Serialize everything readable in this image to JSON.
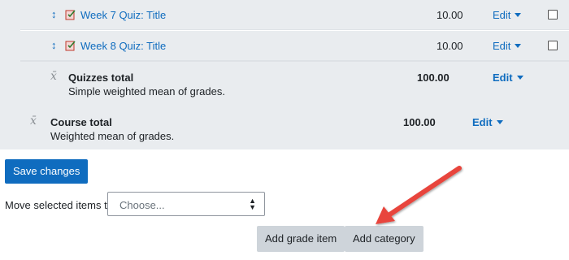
{
  "rows": [
    {
      "title": "Week 7 Quiz: Title",
      "max": "10.00",
      "edit": "Edit"
    },
    {
      "title": "Week 8 Quiz: Title",
      "max": "10.00",
      "edit": "Edit"
    }
  ],
  "category_total": {
    "label": "Quizzes total",
    "description": "Simple weighted mean of grades.",
    "max": "100.00",
    "edit": "Edit"
  },
  "course_total": {
    "label": "Course total",
    "description": "Weighted mean of grades.",
    "max": "100.00",
    "edit": "Edit"
  },
  "actions": {
    "save_label": "Save changes",
    "move_label": "Move selected items to",
    "select_placeholder": "Choose...",
    "add_grade_item": "Add grade item",
    "add_category": "Add category"
  },
  "colors": {
    "accent": "#0f6cbf",
    "row_bg": "#e9ecef",
    "button_secondary": "#ced4da",
    "annotation_arrow": "#e8453c"
  },
  "icons": {
    "move": "move-arrow-icon",
    "quiz": "quiz-icon",
    "aggregation": "sigma-icon",
    "annotation": "red-arrow-annotation"
  }
}
